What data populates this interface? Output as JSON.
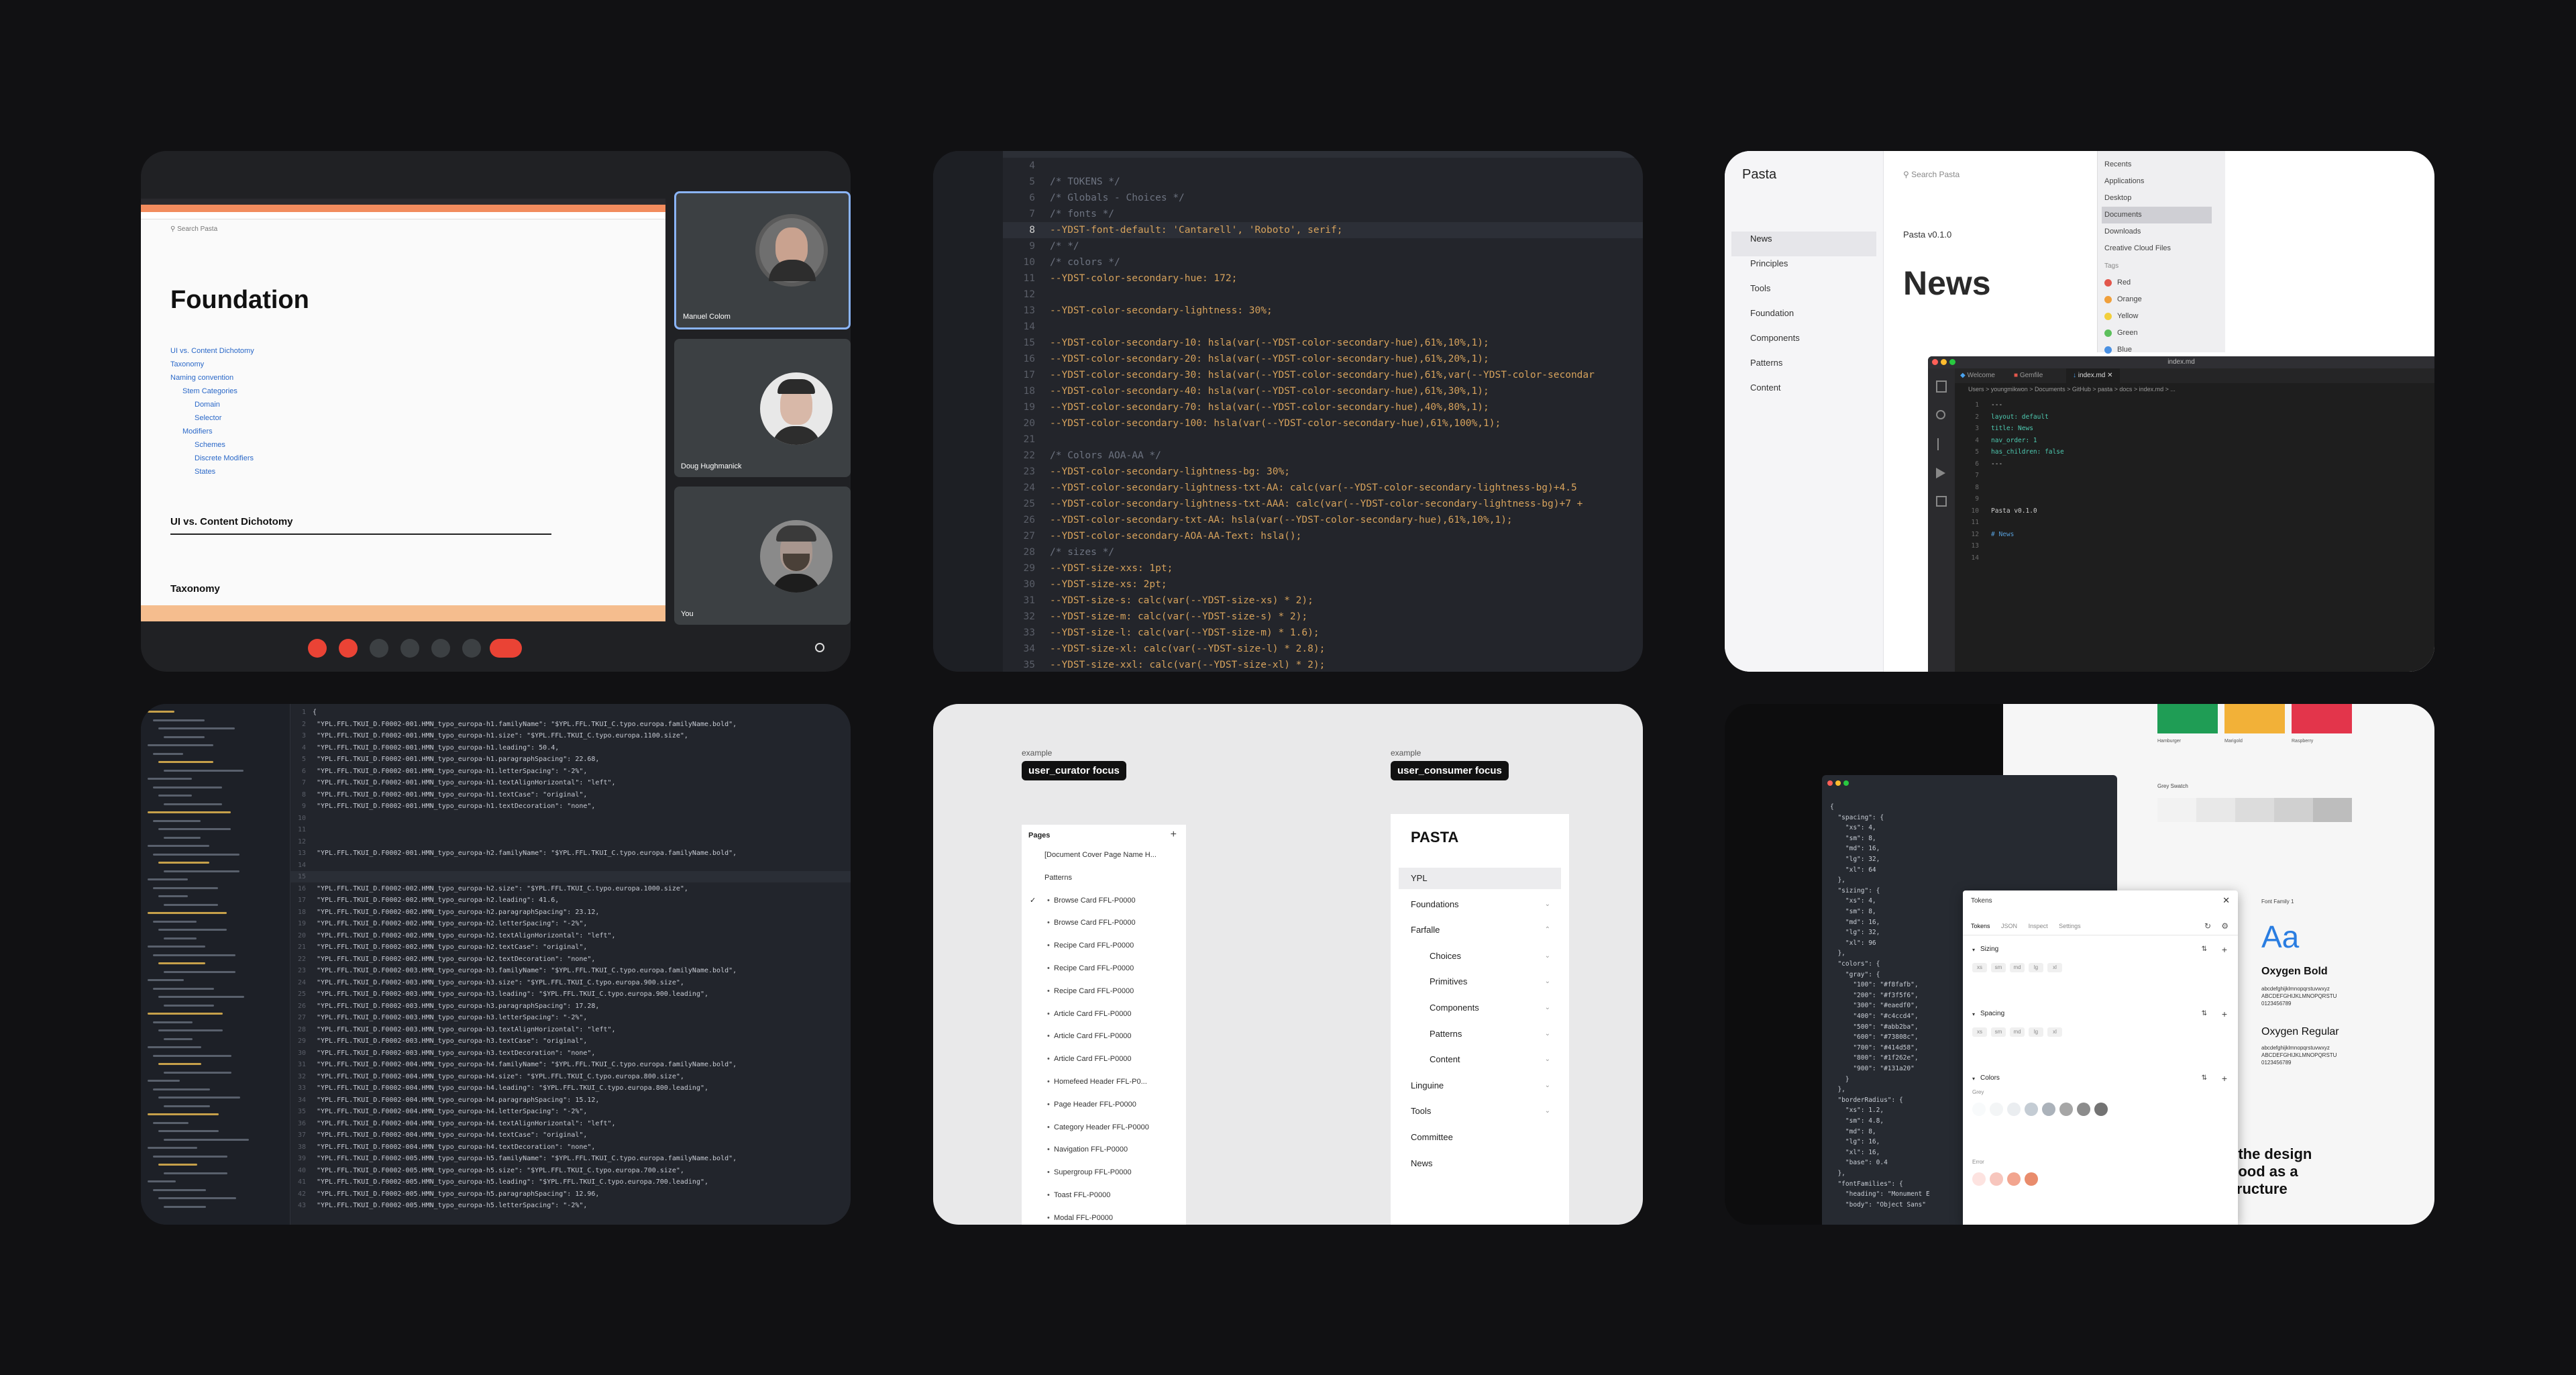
{
  "meet": {
    "doc_title": "Foundation",
    "search_placeholder": "Search Pasta",
    "toc": [
      "UI vs. Content Dichotomy",
      "Taxonomy",
      "Naming convention",
      "Stem Categories",
      "Domain",
      "Selector",
      "Modifiers",
      "Schemes",
      "Discrete Modifiers",
      "States"
    ],
    "section1": "UI vs. Content Dichotomy",
    "section2": "Taxonomy",
    "participants": [
      "Manuel Colom",
      "Doug Hughmanick",
      "You"
    ]
  },
  "code": {
    "lines": [
      {
        "n": "4",
        "t": ""
      },
      {
        "n": "5",
        "t": "/* TOKENS */"
      },
      {
        "n": "6",
        "t": "/* Globals - Choices */"
      },
      {
        "n": "7",
        "t": "/* fonts */"
      },
      {
        "n": "8",
        "t": "--YDST-font-default: 'Cantarell', 'Roboto', serif;"
      },
      {
        "n": "9",
        "t": "/*  */"
      },
      {
        "n": "10",
        "t": "/* colors */"
      },
      {
        "n": "11",
        "t": "--YDST-color-secondary-hue: 172;"
      },
      {
        "n": "12",
        "t": ""
      },
      {
        "n": "13",
        "t": "--YDST-color-secondary-lightness: 30%;"
      },
      {
        "n": "14",
        "t": ""
      },
      {
        "n": "15",
        "t": "--YDST-color-secondary-10: hsla(var(--YDST-color-secondary-hue),61%,10%,1);"
      },
      {
        "n": "16",
        "t": "--YDST-color-secondary-20: hsla(var(--YDST-color-secondary-hue),61%,20%,1);"
      },
      {
        "n": "17",
        "t": "--YDST-color-secondary-30: hsla(var(--YDST-color-secondary-hue),61%,var(--YDST-color-secondar"
      },
      {
        "n": "18",
        "t": "--YDST-color-secondary-40: hsla(var(--YDST-color-secondary-hue),61%,30%,1);"
      },
      {
        "n": "19",
        "t": "--YDST-color-secondary-70: hsla(var(--YDST-color-secondary-hue),40%,80%,1);"
      },
      {
        "n": "20",
        "t": "--YDST-color-secondary-100: hsla(var(--YDST-color-secondary-hue),61%,100%,1);"
      },
      {
        "n": "21",
        "t": ""
      },
      {
        "n": "22",
        "t": "/* Colors AOA-AA */"
      },
      {
        "n": "23",
        "t": "--YDST-color-secondary-lightness-bg: 30%;"
      },
      {
        "n": "24",
        "t": "--YDST-color-secondary-lightness-txt-AA: calc(var(--YDST-color-secondary-lightness-bg)+4.5"
      },
      {
        "n": "25",
        "t": "--YDST-color-secondary-lightness-txt-AAA: calc(var(--YDST-color-secondary-lightness-bg)+7 +"
      },
      {
        "n": "26",
        "t": "--YDST-color-secondary-txt-AA: hsla(var(--YDST-color-secondary-hue),61%,10%,1);"
      },
      {
        "n": "27",
        "t": "--YDST-color-secondary-AOA-AA-Text: hsla();"
      },
      {
        "n": "28",
        "t": "/* sizes */"
      },
      {
        "n": "29",
        "t": "--YDST-size-xxs: 1pt;"
      },
      {
        "n": "30",
        "t": "--YDST-size-xs: 2pt;"
      },
      {
        "n": "31",
        "t": "--YDST-size-s: calc(var(--YDST-size-xs) * 2);"
      },
      {
        "n": "32",
        "t": "--YDST-size-m: calc(var(--YDST-size-s) * 2);"
      },
      {
        "n": "33",
        "t": "--YDST-size-l: calc(var(--YDST-size-m) * 1.6);"
      },
      {
        "n": "34",
        "t": "--YDST-size-xl: calc(var(--YDST-size-l) * 2.8);"
      },
      {
        "n": "35",
        "t": "--YDST-size-xxl: calc(var(--YDST-size-xl) * 2);"
      }
    ]
  },
  "pasta": {
    "app_title": "Pasta",
    "search_placeholder": "Search Pasta",
    "nav": [
      "News",
      "Principles",
      "Tools",
      "Foundation",
      "Components",
      "Patterns",
      "Content"
    ],
    "version": "Pasta v0.1.0",
    "heading": "News",
    "finder": [
      "Recents",
      "Applications",
      "Desktop",
      "Documents",
      "Downloads",
      "Creative Cloud Files"
    ],
    "tags_label": "Tags",
    "tags": [
      {
        "name": "Red",
        "color": "#e2574c"
      },
      {
        "name": "Orange",
        "color": "#f0a03c"
      },
      {
        "name": "Yellow",
        "color": "#f2cf3c"
      },
      {
        "name": "Green",
        "color": "#5cbf5c"
      },
      {
        "name": "Blue",
        "color": "#4a90e2"
      }
    ],
    "editor_title": "index.md",
    "tabs": [
      "Welcome",
      "Gemfile",
      "index.md"
    ],
    "breadcrumb": "Users > youngmikwon > Documents > GitHub > pasta > docs > index.md > ...",
    "lines": [
      {
        "n": "1",
        "t": "---"
      },
      {
        "n": "2",
        "t": "layout: default"
      },
      {
        "n": "3",
        "t": "title: News"
      },
      {
        "n": "4",
        "t": "nav_order: 1"
      },
      {
        "n": "5",
        "t": "has_children: false"
      },
      {
        "n": "6",
        "t": "---"
      },
      {
        "n": "7",
        "t": ""
      },
      {
        "n": "8",
        "t": ""
      },
      {
        "n": "9",
        "t": ""
      },
      {
        "n": "10",
        "t": "Pasta v0.1.0"
      },
      {
        "n": "11",
        "t": ""
      },
      {
        "n": "12",
        "t": "# News"
      },
      {
        "n": "13",
        "t": ""
      },
      {
        "n": "14",
        "t": ""
      }
    ]
  },
  "json_editor": {
    "lines": [
      {
        "n": "1",
        "t": "{"
      },
      {
        "n": "2",
        "t": "  \"YPL.FFL.TKUI_D.F0002-001.HMN_typo_europa-h1.familyName\": \"$YPL.FFL.TKUI_C.typo.europa.familyName.bold\","
      },
      {
        "n": "3",
        "t": "  \"YPL.FFL.TKUI_D.F0002-001.HMN_typo_europa-h1.size\": \"$YPL.FFL.TKUI_C.typo.europa.1100.size\","
      },
      {
        "n": "4",
        "t": "  \"YPL.FFL.TKUI_D.F0002-001.HMN_typo_europa-h1.leading\": 50.4,"
      },
      {
        "n": "5",
        "t": "  \"YPL.FFL.TKUI_D.F0002-001.HMN_typo_europa-h1.paragraphSpacing\": 22.68,"
      },
      {
        "n": "6",
        "t": "  \"YPL.FFL.TKUI_D.F0002-001.HMN_typo_europa-h1.letterSpacing\": \"-2%\","
      },
      {
        "n": "7",
        "t": "  \"YPL.FFL.TKUI_D.F0002-001.HMN_typo_europa-h1.textAlignHorizontal\": \"left\","
      },
      {
        "n": "8",
        "t": "  \"YPL.FFL.TKUI_D.F0002-001.HMN_typo_europa-h1.textCase\": \"original\","
      },
      {
        "n": "9",
        "t": "  \"YPL.FFL.TKUI_D.F0002-001.HMN_typo_europa-h1.textDecoration\": \"none\","
      },
      {
        "n": "10",
        "t": ""
      },
      {
        "n": "11",
        "t": ""
      },
      {
        "n": "12",
        "t": ""
      },
      {
        "n": "13",
        "t": "  \"YPL.FFL.TKUI_D.F0002-001.HMN_typo_europa-h2.familyName\": \"$YPL.FFL.TKUI_C.typo.europa.familyName.bold\","
      },
      {
        "n": "14",
        "t": ""
      },
      {
        "n": "15",
        "t": ""
      },
      {
        "n": "16",
        "t": "  \"YPL.FFL.TKUI_D.F0002-002.HMN_typo_europa-h2.size\": \"$YPL.FFL.TKUI_C.typo.europa.1000.size\","
      },
      {
        "n": "17",
        "t": "  \"YPL.FFL.TKUI_D.F0002-002.HMN_typo_europa-h2.leading\": 41.6,"
      },
      {
        "n": "18",
        "t": "  \"YPL.FFL.TKUI_D.F0002-002.HMN_typo_europa-h2.paragraphSpacing\": 23.12,"
      },
      {
        "n": "19",
        "t": "  \"YPL.FFL.TKUI_D.F0002-002.HMN_typo_europa-h2.letterSpacing\": \"-2%\","
      },
      {
        "n": "20",
        "t": "  \"YPL.FFL.TKUI_D.F0002-002.HMN_typo_europa-h2.textAlignHorizontal\": \"left\","
      },
      {
        "n": "21",
        "t": "  \"YPL.FFL.TKUI_D.F0002-002.HMN_typo_europa-h2.textCase\": \"original\","
      },
      {
        "n": "22",
        "t": "  \"YPL.FFL.TKUI_D.F0002-002.HMN_typo_europa-h2.textDecoration\": \"none\","
      },
      {
        "n": "23",
        "t": "  \"YPL.FFL.TKUI_D.F0002-003.HMN_typo_europa-h3.familyName\": \"$YPL.FFL.TKUI_C.typo.europa.familyName.bold\","
      },
      {
        "n": "24",
        "t": "  \"YPL.FFL.TKUI_D.F0002-003.HMN_typo_europa-h3.size\": \"$YPL.FFL.TKUI_C.typo.europa.900.size\","
      },
      {
        "n": "25",
        "t": "  \"YPL.FFL.TKUI_D.F0002-003.HMN_typo_europa-h3.leading\": \"$YPL.FFL.TKUI_C.typo.europa.900.leading\","
      },
      {
        "n": "26",
        "t": "  \"YPL.FFL.TKUI_D.F0002-003.HMN_typo_europa-h3.paragraphSpacing\": 17.28,"
      },
      {
        "n": "27",
        "t": "  \"YPL.FFL.TKUI_D.F0002-003.HMN_typo_europa-h3.letterSpacing\": \"-2%\","
      },
      {
        "n": "28",
        "t": "  \"YPL.FFL.TKUI_D.F0002-003.HMN_typo_europa-h3.textAlignHorizontal\": \"left\","
      },
      {
        "n": "29",
        "t": "  \"YPL.FFL.TKUI_D.F0002-003.HMN_typo_europa-h3.textCase\": \"original\","
      },
      {
        "n": "30",
        "t": "  \"YPL.FFL.TKUI_D.F0002-003.HMN_typo_europa-h3.textDecoration\": \"none\","
      },
      {
        "n": "31",
        "t": "  \"YPL.FFL.TKUI_D.F0002-004.HMN_typo_europa-h4.familyName\": \"$YPL.FFL.TKUI_C.typo.europa.familyName.bold\","
      },
      {
        "n": "32",
        "t": "  \"YPL.FFL.TKUI_D.F0002-004.HMN_typo_europa-h4.size\": \"$YPL.FFL.TKUI_C.typo.europa.800.size\","
      },
      {
        "n": "33",
        "t": "  \"YPL.FFL.TKUI_D.F0002-004.HMN_typo_europa-h4.leading\": \"$YPL.FFL.TKUI_C.typo.europa.800.leading\","
      },
      {
        "n": "34",
        "t": "  \"YPL.FFL.TKUI_D.F0002-004.HMN_typo_europa-h4.paragraphSpacing\": 15.12,"
      },
      {
        "n": "35",
        "t": "  \"YPL.FFL.TKUI_D.F0002-004.HMN_typo_europa-h4.letterSpacing\": \"-2%\","
      },
      {
        "n": "36",
        "t": "  \"YPL.FFL.TKUI_D.F0002-004.HMN_typo_europa-h4.textAlignHorizontal\": \"left\","
      },
      {
        "n": "37",
        "t": "  \"YPL.FFL.TKUI_D.F0002-004.HMN_typo_europa-h4.textCase\": \"original\","
      },
      {
        "n": "38",
        "t": "  \"YPL.FFL.TKUI_D.F0002-004.HMN_typo_europa-h4.textDecoration\": \"none\","
      },
      {
        "n": "39",
        "t": "  \"YPL.FFL.TKUI_D.F0002-005.HMN_typo_europa-h5.familyName\": \"$YPL.FFL.TKUI_C.typo.europa.familyName.bold\","
      },
      {
        "n": "40",
        "t": "  \"YPL.FFL.TKUI_D.F0002-005.HMN_typo_europa-h5.size\": \"$YPL.FFL.TKUI_C.typo.europa.700.size\","
      },
      {
        "n": "41",
        "t": "  \"YPL.FFL.TKUI_D.F0002-005.HMN_typo_europa-h5.leading\": \"$YPL.FFL.TKUI_C.typo.europa.700.leading\","
      },
      {
        "n": "42",
        "t": "  \"YPL.FFL.TKUI_D.F0002-005.HMN_typo_europa-h5.paragraphSpacing\": 12.96,"
      },
      {
        "n": "43",
        "t": "  \"YPL.FFL.TKUI_D.F0002-005.HMN_typo_europa-h5.letterSpacing\": \"-2%\","
      }
    ]
  },
  "focus": {
    "label_small": "example",
    "curator_label": "user_curator focus",
    "consumer_label": "user_consumer focus",
    "pages_title": "Pages",
    "pages": [
      "[Document Cover Page Name H...",
      "Patterns",
      "Browse Card FFL-P0000",
      "Browse Card FFL-P0000",
      "Recipe Card FFL-P0000",
      "Recipe Card FFL-P0000",
      "Recipe Card FFL-P0000",
      "Article Card FFL-P0000",
      "Article Card FFL-P0000",
      "Article Card FFL-P0000",
      "Homefeed Header FFL-P0...",
      "Page Header FFL-P0000",
      "Category Header FFL-P0000",
      "Navigation FFL-P0000",
      "Supergroup FFL-P0000",
      "Toast FFL-P0000",
      "Modal FFL-P0000"
    ],
    "site_title": "PASTA",
    "site_nav": [
      "YPL",
      "Foundations",
      "Farfalle",
      "Choices",
      "Primitives",
      "Components",
      "Patterns",
      "Content",
      "Linguine",
      "Tools",
      "Committee",
      "News"
    ]
  },
  "tokens": {
    "json_lines": [
      "{",
      "  \"spacing\": {",
      "    \"xs\": 4,",
      "    \"sm\": 8,",
      "    \"md\": 16,",
      "    \"lg\": 32,",
      "    \"xl\": 64",
      "  },",
      "  \"sizing\": {",
      "    \"xs\": 4,",
      "    \"sm\": 8,",
      "    \"md\": 16,",
      "    \"lg\": 32,",
      "    \"xl\": 96",
      "  },",
      "  \"colors\": {",
      "    \"gray\": {",
      "      \"100\": \"#f8fafb\",",
      "      \"200\": \"#f3f5f6\",",
      "      \"300\": \"#eaedf0\",",
      "      \"400\": \"#c4ccd4\",",
      "      \"500\": \"#abb2ba\",",
      "      \"600\": \"#73808c\",",
      "      \"700\": \"#414d58\",",
      "      \"800\": \"#1f262e\",",
      "      \"900\": \"#131a20\"",
      "    }",
      "  },",
      "  \"borderRadius\": {",
      "    \"xs\": 1.2,",
      "    \"sm\": 4.8,",
      "    \"md\": 8,",
      "    \"lg\": 16,",
      "    \"xl\": 16,",
      "    \"base\": 0.4",
      "  },",
      "  \"fontFamilies\": {",
      "    \"heading\": \"Monument E",
      "    \"body\": \"Object Sans\""
    ],
    "panel_title": "Tokens",
    "panel_tabs": [
      "Tokens",
      "JSON",
      "Inspect",
      "Settings"
    ],
    "sections": [
      "Sizing",
      "Spacing",
      "Colors"
    ],
    "chips": [
      "xs",
      "sm",
      "md",
      "lg",
      "xl"
    ],
    "gray_label": "Grey",
    "error_label": "Error",
    "gray_swatches": [
      "#f8fafb",
      "#f3f5f6",
      "#eaedf0",
      "#c4ccd4",
      "#abb2ba",
      "#a6a6a6",
      "#8c8c8c",
      "#737373"
    ],
    "error_swatches": [
      "#fde3e0",
      "#f7c6bd",
      "#f2a58f",
      "#e98c6c"
    ],
    "brand_colors": [
      "#1f9d55",
      "#f2b138",
      "#e3354b"
    ],
    "brand_names": [
      "Hamburger",
      "Marigold",
      "Raspberry"
    ],
    "grey_swatch_label": "Grey Swatch",
    "font_specimen": "Aa",
    "font_family_label": "Font Family 1",
    "font_bold": "Oxygen Bold",
    "font_regular": "Oxygen Regular",
    "specimen_lower": "abcdefghijklmnopqrstuvwxyz",
    "specimen_upper": "ABCDEFGHIJKLMNOPQRSTU",
    "specimen_digits": "0123456789",
    "headline": [
      "t of the design",
      "erstood as a",
      "e structure"
    ]
  }
}
